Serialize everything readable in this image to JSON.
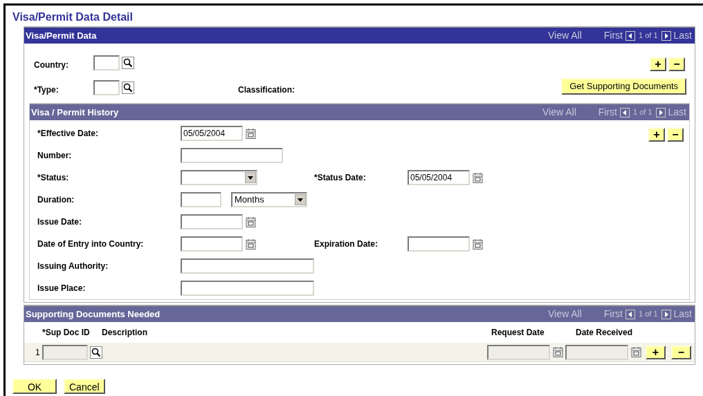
{
  "page_title": "Visa/Permit Data Detail",
  "visa_permit_data": {
    "title": "Visa/Permit Data",
    "nav": {
      "view_all": "View All",
      "first": "First",
      "count": "1 of 1",
      "last": "Last"
    },
    "fields": [
      {
        "label": "Country:",
        "kind": "lookup"
      },
      {
        "label": "*Type:",
        "kind": "lookup"
      }
    ],
    "classification_label": "Classification:",
    "row_buttons": [
      "+",
      "−"
    ],
    "action_button": "Get Supporting Documents"
  },
  "history": {
    "title": "Visa / Permit History",
    "nav": {
      "view_all": "View All",
      "first": "First",
      "count": "1 of 1",
      "last": "Last"
    },
    "row_buttons": [
      "+",
      "−"
    ],
    "rows": [
      {
        "fields": [
          {
            "label": "*Effective Date:",
            "kind": "date",
            "value": "05/05/2004"
          }
        ]
      },
      {
        "fields": [
          {
            "label": "Number:",
            "kind": "text"
          }
        ]
      },
      {
        "fields": [
          {
            "label": "*Status:",
            "kind": "select"
          },
          {
            "label": "*Status Date:",
            "kind": "date",
            "value": "05/05/2004"
          }
        ]
      },
      {
        "fields": [
          {
            "label": "Duration:",
            "kind": "number_unit",
            "unit": "Months"
          }
        ]
      },
      {
        "fields": [
          {
            "label": "Issue Date:",
            "kind": "date"
          }
        ]
      },
      {
        "fields": [
          {
            "label": "Date of Entry into Country:",
            "kind": "date"
          },
          {
            "label": "Expiration Date:",
            "kind": "date"
          }
        ]
      },
      {
        "fields": [
          {
            "label": "Issuing Authority:",
            "kind": "long_text"
          }
        ]
      },
      {
        "fields": [
          {
            "label": "Issue Place:",
            "kind": "medium_text"
          }
        ]
      }
    ]
  },
  "supporting_documents": {
    "title": "Supporting Documents Needed",
    "nav": {
      "view_all": "View All",
      "first": "First",
      "count": "1 of 1",
      "last": "Last"
    },
    "columns": [
      "*Sup Doc ID",
      "Description",
      "Request Date",
      "Date Received"
    ],
    "rows": [
      {
        "number": "1",
        "disabled": true,
        "row_buttons": [
          "+",
          "−"
        ]
      }
    ]
  },
  "buttons": [
    "OK",
    "Cancel"
  ]
}
